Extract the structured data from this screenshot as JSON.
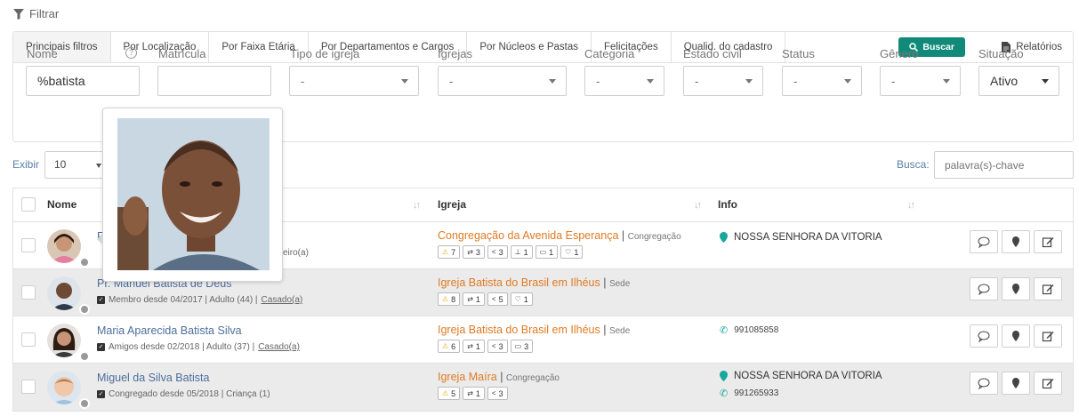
{
  "filter_toggle": "Filtrar",
  "tabs": [
    {
      "label": "Principais filtros",
      "active": true
    },
    {
      "label": "Por Localização"
    },
    {
      "label": "Por Faixa Etária"
    },
    {
      "label": "Por Departamentos e Cargos"
    },
    {
      "label": "Por Núcleos e Pastas"
    },
    {
      "label": "Felicitações"
    },
    {
      "label": "Qualid. do cadastro"
    }
  ],
  "actions": {
    "buscar": "Buscar",
    "relatorios": "Relatórios"
  },
  "filters": {
    "nome": {
      "label": "Nome",
      "value": "%batista",
      "help": "?"
    },
    "matricula": {
      "label": "Matrícula",
      "value": ""
    },
    "tipo_igreja": {
      "label": "Tipo de igreja",
      "value": "-"
    },
    "igrejas": {
      "label": "Igrejas",
      "value": "-"
    },
    "categoria": {
      "label": "Categoria",
      "value": "-"
    },
    "estado_civil": {
      "label": "Estado civil",
      "value": "-"
    },
    "status": {
      "label": "Status",
      "value": "-"
    },
    "genero": {
      "label": "Gênero",
      "value": "-"
    },
    "situacao": {
      "label": "Situação",
      "value": "Ativo"
    }
  },
  "table_controls": {
    "exibir_label": "Exibir",
    "exibir_value": "10",
    "busca_label": "Busca:",
    "busca_placeholder": "palavra(s)-chave"
  },
  "columns": {
    "nome": "Nome",
    "igreja": "Igreja",
    "info": "Info"
  },
  "rows": [
    {
      "name": "F",
      "meta": "eiro(a)",
      "church": "Congregação da Avenida Esperança",
      "church_type": "Congregação",
      "chips": [
        {
          "icon": "bell-icon",
          "glyph": "🔔",
          "count": "7"
        },
        {
          "icon": "retweet-icon",
          "glyph": "⇄",
          "count": "3"
        },
        {
          "icon": "share-icon",
          "glyph": "<",
          "count": "3"
        },
        {
          "icon": "sitemap-icon",
          "glyph": "⊥",
          "count": "1"
        },
        {
          "icon": "folder-icon",
          "glyph": "▭",
          "count": "1"
        },
        {
          "icon": "heart-icon",
          "glyph": "♡",
          "count": "1"
        }
      ],
      "address": "NOSSA SENHORA DA VITORIA",
      "phone": ""
    },
    {
      "name": "Pr. Manuel Batista de Deus",
      "meta_prefix": "Membro desde 04/2017 | Adulto (44) |",
      "meta_link": "Casado(a)",
      "church": "Igreja Batista do Brasil em Ilhéus",
      "church_type": "Sede",
      "chips": [
        {
          "icon": "bell-icon",
          "glyph": "🔔",
          "count": "8"
        },
        {
          "icon": "retweet-icon",
          "glyph": "⇄",
          "count": "1"
        },
        {
          "icon": "share-icon",
          "glyph": "<",
          "count": "5"
        },
        {
          "icon": "heart-icon",
          "glyph": "♡",
          "count": "1"
        }
      ],
      "address": "",
      "phone": ""
    },
    {
      "name": "Maria Aparecida Batista Silva",
      "meta_prefix": "Amigos desde 02/2018 | Adulto (37) |",
      "meta_link": "Casado(a)",
      "church": "Igreja Batista do Brasil em Ilhéus",
      "church_type": "Sede",
      "chips": [
        {
          "icon": "bell-icon",
          "glyph": "🔔",
          "count": "6"
        },
        {
          "icon": "retweet-icon",
          "glyph": "⇄",
          "count": "1"
        },
        {
          "icon": "share-icon",
          "glyph": "<",
          "count": "3"
        },
        {
          "icon": "folder-icon",
          "glyph": "▭",
          "count": "3"
        }
      ],
      "address": "",
      "phone": "991085858"
    },
    {
      "name": "Miguel da Silva Batista",
      "meta_prefix": "Congregado desde 05/2018 | Criança (1)",
      "meta_link": "",
      "church": "Igreja Maíra",
      "church_type": "Congregação",
      "chips": [
        {
          "icon": "bell-icon",
          "glyph": "🔔",
          "count": "5"
        },
        {
          "icon": "retweet-icon",
          "glyph": "⇄",
          "count": "1"
        },
        {
          "icon": "share-icon",
          "glyph": "<",
          "count": "3"
        }
      ],
      "address": "NOSSA SENHORA DA VITORIA",
      "phone": "991265933"
    }
  ],
  "colors": {
    "accent": "#128a7a",
    "church_link": "#e07a22",
    "name_link": "#4e6e9c",
    "pin": "#16a89b"
  }
}
